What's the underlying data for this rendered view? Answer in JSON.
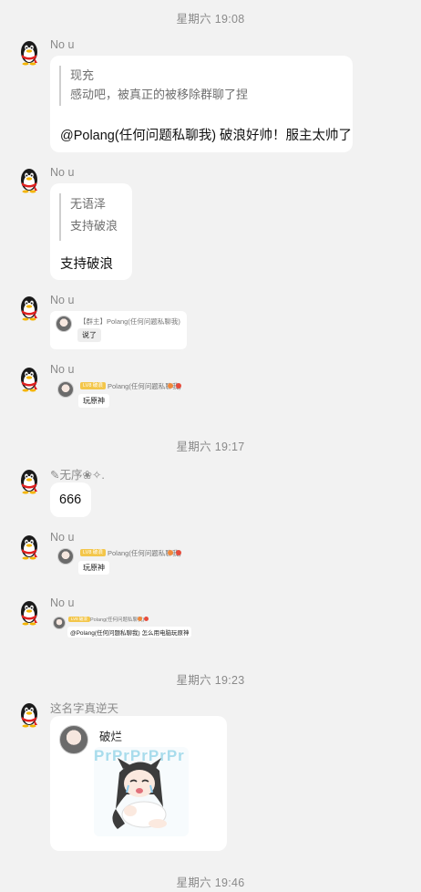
{
  "timestamps": [
    "星期六 19:08",
    "星期六 19:17",
    "星期六 19:23",
    "星期六 19:46"
  ],
  "messages": [
    {
      "sender": "No u",
      "quote_lines": [
        "现充",
        "感动吧，被真正的被移除群聊了捏"
      ],
      "text": "@Polang(任何问题私聊我) 破浪好帅！服主太帅了"
    },
    {
      "sender": "No u",
      "quote_lines": [
        "无语泽",
        "支持破浪"
      ],
      "text": "支持破浪"
    },
    {
      "sender": "No u",
      "mini_name": "【群主】Polang(任何问题私聊我)",
      "mini_text": "说了"
    },
    {
      "sender": "No u",
      "mini_tag": "LV8 破浪",
      "mini_name": "Polang(任何问题私聊我)",
      "mini_text": "玩原神"
    },
    {
      "sender": "✎无序❀✧.",
      "text": "666"
    },
    {
      "sender": "No u",
      "mini_tag": "LV8 破浪",
      "mini_name": "Polang(任何问题私聊我)",
      "mini_text": "玩原神"
    },
    {
      "sender": "No u",
      "mini_tag": "LV8 破浪",
      "mini_name": "Polang(任何问题私聊我)",
      "mini_text": "@Polang(任何问题私聊我) 怎么用电脑玩原神"
    },
    {
      "sender": "这名字真逆天",
      "sticker_name": "破烂",
      "sticker_bg_text": "PrPrPrPrPr"
    }
  ],
  "icons": {
    "avatar": "qq-penguin-icon",
    "mini_avatar": "anime-girl-avatar",
    "sticker": "crying-anime-girl-sticker"
  },
  "colors": {
    "background": "#f2f2f2",
    "bubble": "#ffffff",
    "timestamp": "#8a8a8a",
    "tag": "#f3c64a"
  }
}
